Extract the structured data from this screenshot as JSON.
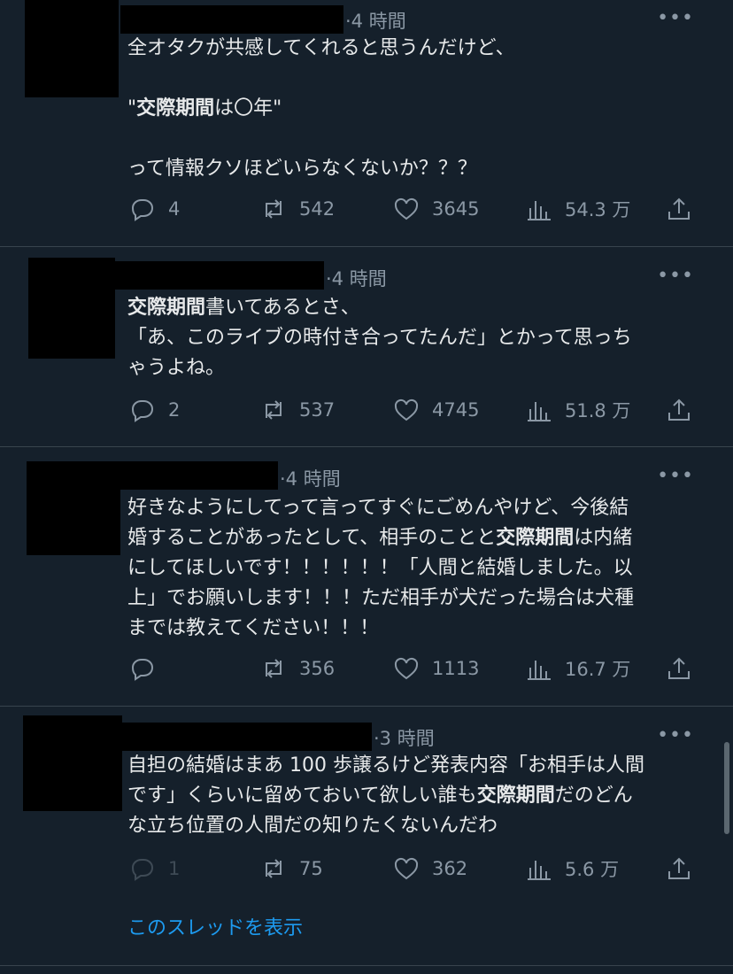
{
  "tweets": [
    {
      "time": "·4 時間",
      "lines": [
        [
          {
            "t": "全オタクが共感してくれると思うんだけど、",
            "b": false
          }
        ],
        [],
        [
          {
            "t": "\"",
            "b": false
          },
          {
            "t": "交際期間",
            "b": true
          },
          {
            "t": "は〇年\"",
            "b": false
          }
        ],
        [],
        [
          {
            "t": "って情報クソほどいらなくないか？？？",
            "b": false
          }
        ]
      ],
      "replies": "4",
      "retweets": "542",
      "likes": "3645",
      "views": "54.3 万"
    },
    {
      "time": "·4 時間",
      "lines": [
        [
          {
            "t": "交際期間",
            "b": true
          },
          {
            "t": "書いてあるとさ、",
            "b": false
          }
        ],
        [
          {
            "t": "「あ、このライブの時付き合ってたんだ」とかって思っち",
            "b": false
          }
        ],
        [
          {
            "t": "ゃうよね。",
            "b": false
          }
        ]
      ],
      "replies": "2",
      "retweets": "537",
      "likes": "4745",
      "views": "51.8 万"
    },
    {
      "time": "·4 時間",
      "lines": [
        [
          {
            "t": "好きなようにしてって言ってすぐにごめんやけど、今後結",
            "b": false
          }
        ],
        [
          {
            "t": "婚することがあったとして、相手のことと",
            "b": false
          },
          {
            "t": "交際期間",
            "b": true
          },
          {
            "t": "は内緒",
            "b": false
          }
        ],
        [
          {
            "t": "にしてほしいです！！！！！！「人間と結婚しました。以",
            "b": false
          }
        ],
        [
          {
            "t": "上」でお願いします！！！ただ相手が犬だった場合は犬種",
            "b": false
          }
        ],
        [
          {
            "t": "までは教えてください！！！",
            "b": false
          }
        ]
      ],
      "replies": "",
      "retweets": "356",
      "likes": "1113",
      "views": "16.7 万"
    },
    {
      "time": "·3 時間",
      "lines": [
        [
          {
            "t": "自担の結婚はまあ 100 歩譲るけど発表内容「お相手は人間",
            "b": false
          }
        ],
        [
          {
            "t": "です」くらいに留めておいて欲しい誰も",
            "b": false
          },
          {
            "t": "交際期間",
            "b": true
          },
          {
            "t": "だのどん",
            "b": false
          }
        ],
        [
          {
            "t": "な立ち位置の人間だの知りたくないんだわ",
            "b": false
          }
        ]
      ],
      "replies": "1",
      "retweets": "75",
      "likes": "362",
      "views": "5.6 万"
    }
  ],
  "more_label": "•••",
  "thread_link": "このスレッドを表示",
  "colors": {
    "background": "#15202b",
    "text": "#e7e9ea",
    "muted": "#8b98a5",
    "link": "#1d9bf0",
    "divider": "#38444d"
  },
  "icons": [
    "reply-icon",
    "retweet-icon",
    "like-icon",
    "views-icon",
    "share-icon",
    "more-icon"
  ]
}
